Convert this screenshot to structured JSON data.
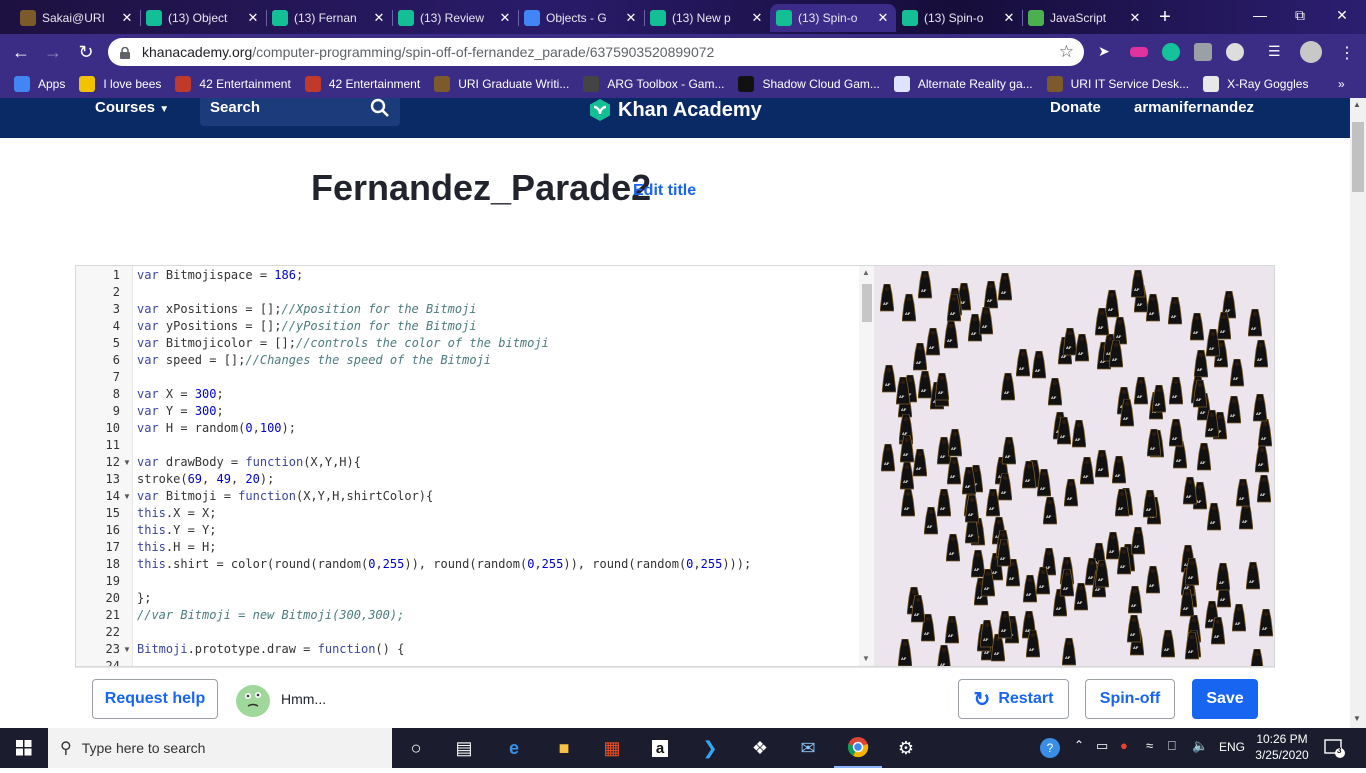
{
  "browser": {
    "tabs": [
      {
        "title": "Sakai@URI",
        "icon": "uri-icon",
        "active": false
      },
      {
        "title": "(13) Object",
        "icon": "khan-icon",
        "active": false
      },
      {
        "title": "(13) Fernan",
        "icon": "khan-icon",
        "active": false
      },
      {
        "title": "(13) Review",
        "icon": "khan-icon",
        "active": false
      },
      {
        "title": "Objects - G",
        "icon": "google-docs-icon",
        "active": false
      },
      {
        "title": "(13) New p",
        "icon": "khan-icon",
        "active": false
      },
      {
        "title": "(13) Spin-o",
        "icon": "khan-icon",
        "active": true
      },
      {
        "title": "(13) Spin-o",
        "icon": "khan-icon",
        "active": false
      },
      {
        "title": "JavaScript",
        "icon": "w3schools-icon",
        "active": false
      }
    ],
    "new_tab_label": "+",
    "address": {
      "host": "khanacademy.org",
      "path": "/computer-programming/spin-off-of-fernandez_parade/6375903520899072"
    },
    "bookmarks": [
      {
        "label": "Apps",
        "icon": "apps-grid-icon"
      },
      {
        "label": "I love bees",
        "icon": "bee-icon"
      },
      {
        "label": "42 Entertainment",
        "icon": "star-icon"
      },
      {
        "label": "42 Entertainment",
        "icon": "star-icon"
      },
      {
        "label": "URI Graduate Writi...",
        "icon": "uri-icon"
      },
      {
        "label": "ARG Toolbox - Gam...",
        "icon": "arg-icon"
      },
      {
        "label": "Shadow Cloud Gam...",
        "icon": "shadow-icon"
      },
      {
        "label": "Alternate Reality ga...",
        "icon": "page-icon"
      },
      {
        "label": "URI IT Service Desk...",
        "icon": "uri-icon"
      },
      {
        "label": "X-Ray Goggles",
        "icon": "goggles-icon"
      }
    ]
  },
  "ka_header": {
    "courses_label": "Courses",
    "search_label": "Search",
    "logo_text": "Khan Academy",
    "donate_label": "Donate",
    "username": "armanifernandez"
  },
  "program": {
    "title": "Fernandez_Parade2",
    "edit_title_label": "Edit title"
  },
  "code_lines": [
    [
      [
        "kw",
        "var"
      ],
      [
        "pn",
        " Bitmojispace = "
      ],
      [
        "num",
        "186"
      ],
      [
        "pn",
        ";"
      ]
    ],
    [],
    [
      [
        "kw",
        "var"
      ],
      [
        "pn",
        " xPositions = [];"
      ],
      [
        "cm",
        "//Xposition for the Bitmoji"
      ]
    ],
    [
      [
        "kw",
        "var"
      ],
      [
        "pn",
        " yPositions = [];"
      ],
      [
        "cm",
        "//yPosition for the Bitmoji"
      ]
    ],
    [
      [
        "kw",
        "var"
      ],
      [
        "pn",
        " Bitmojicolor = [];"
      ],
      [
        "cm",
        "//controls the color of the bitmoji"
      ]
    ],
    [
      [
        "kw",
        "var"
      ],
      [
        "pn",
        " speed = [];"
      ],
      [
        "cm",
        "//Changes the speed of the Bitmoji"
      ]
    ],
    [],
    [
      [
        "kw",
        "var"
      ],
      [
        "pn",
        " X = "
      ],
      [
        "num",
        "300"
      ],
      [
        "pn",
        ";"
      ]
    ],
    [
      [
        "kw",
        "var"
      ],
      [
        "pn",
        " Y = "
      ],
      [
        "num",
        "300"
      ],
      [
        "pn",
        ";"
      ]
    ],
    [
      [
        "kw",
        "var"
      ],
      [
        "pn",
        " H = random("
      ],
      [
        "num",
        "0"
      ],
      [
        "pn",
        ","
      ],
      [
        "num",
        "100"
      ],
      [
        "pn",
        ");"
      ]
    ],
    [],
    [
      [
        "kw",
        "var"
      ],
      [
        "pn",
        " drawBody = "
      ],
      [
        "kw",
        "function"
      ],
      [
        "pn",
        "(X,Y,H){"
      ]
    ],
    [
      [
        "pn",
        "stroke("
      ],
      [
        "num",
        "69"
      ],
      [
        "pn",
        ", "
      ],
      [
        "num",
        "49"
      ],
      [
        "pn",
        ", "
      ],
      [
        "num",
        "20"
      ],
      [
        "pn",
        ");"
      ]
    ],
    [
      [
        "kw",
        "var"
      ],
      [
        "pn",
        " Bitmoji = "
      ],
      [
        "kw",
        "function"
      ],
      [
        "pn",
        "(X,Y,H,shirtColor){"
      ]
    ],
    [
      [
        "kw",
        "this"
      ],
      [
        "pn",
        ".X = X;"
      ]
    ],
    [
      [
        "kw",
        "this"
      ],
      [
        "pn",
        ".Y = Y;"
      ]
    ],
    [
      [
        "kw",
        "this"
      ],
      [
        "pn",
        ".H = H;"
      ]
    ],
    [
      [
        "kw",
        "this"
      ],
      [
        "pn",
        ".shirt = color(round(random("
      ],
      [
        "num",
        "0"
      ],
      [
        "pn",
        ","
      ],
      [
        "num",
        "255"
      ],
      [
        "pn",
        ")), round(random("
      ],
      [
        "num",
        "0"
      ],
      [
        "pn",
        ","
      ],
      [
        "num",
        "255"
      ],
      [
        "pn",
        ")), round(random("
      ],
      [
        "num",
        "0"
      ],
      [
        "pn",
        ","
      ],
      [
        "num",
        "255"
      ],
      [
        "pn",
        ")));"
      ]
    ],
    [],
    [
      [
        "pn",
        "};"
      ]
    ],
    [
      [
        "cm",
        "//var Bitmoji = new Bitmoji(300,300);"
      ]
    ],
    [],
    [
      [
        "kw",
        "Bitmoji"
      ],
      [
        "pn",
        ".prototype.draw = "
      ],
      [
        "kw",
        "function"
      ],
      [
        "pn",
        "() {"
      ]
    ],
    []
  ],
  "fold_lines": [
    12,
    14,
    23
  ],
  "canvas": {
    "background": "#ede5ee",
    "sprite_label": "AF"
  },
  "bottom_bar": {
    "request_help_label": "Request help",
    "hmm_label": "Hmm...",
    "restart_label": "Restart",
    "spinoff_label": "Spin-off",
    "save_label": "Save"
  },
  "taskbar": {
    "search_placeholder": "Type here to search",
    "time": "10:26 PM",
    "date": "3/25/2020",
    "language": "ENG",
    "notification_count": "3"
  },
  "colors": {
    "ka_blue": "#1865f2",
    "ka_navy": "#0a2a66",
    "ka_green": "#14bf96"
  }
}
